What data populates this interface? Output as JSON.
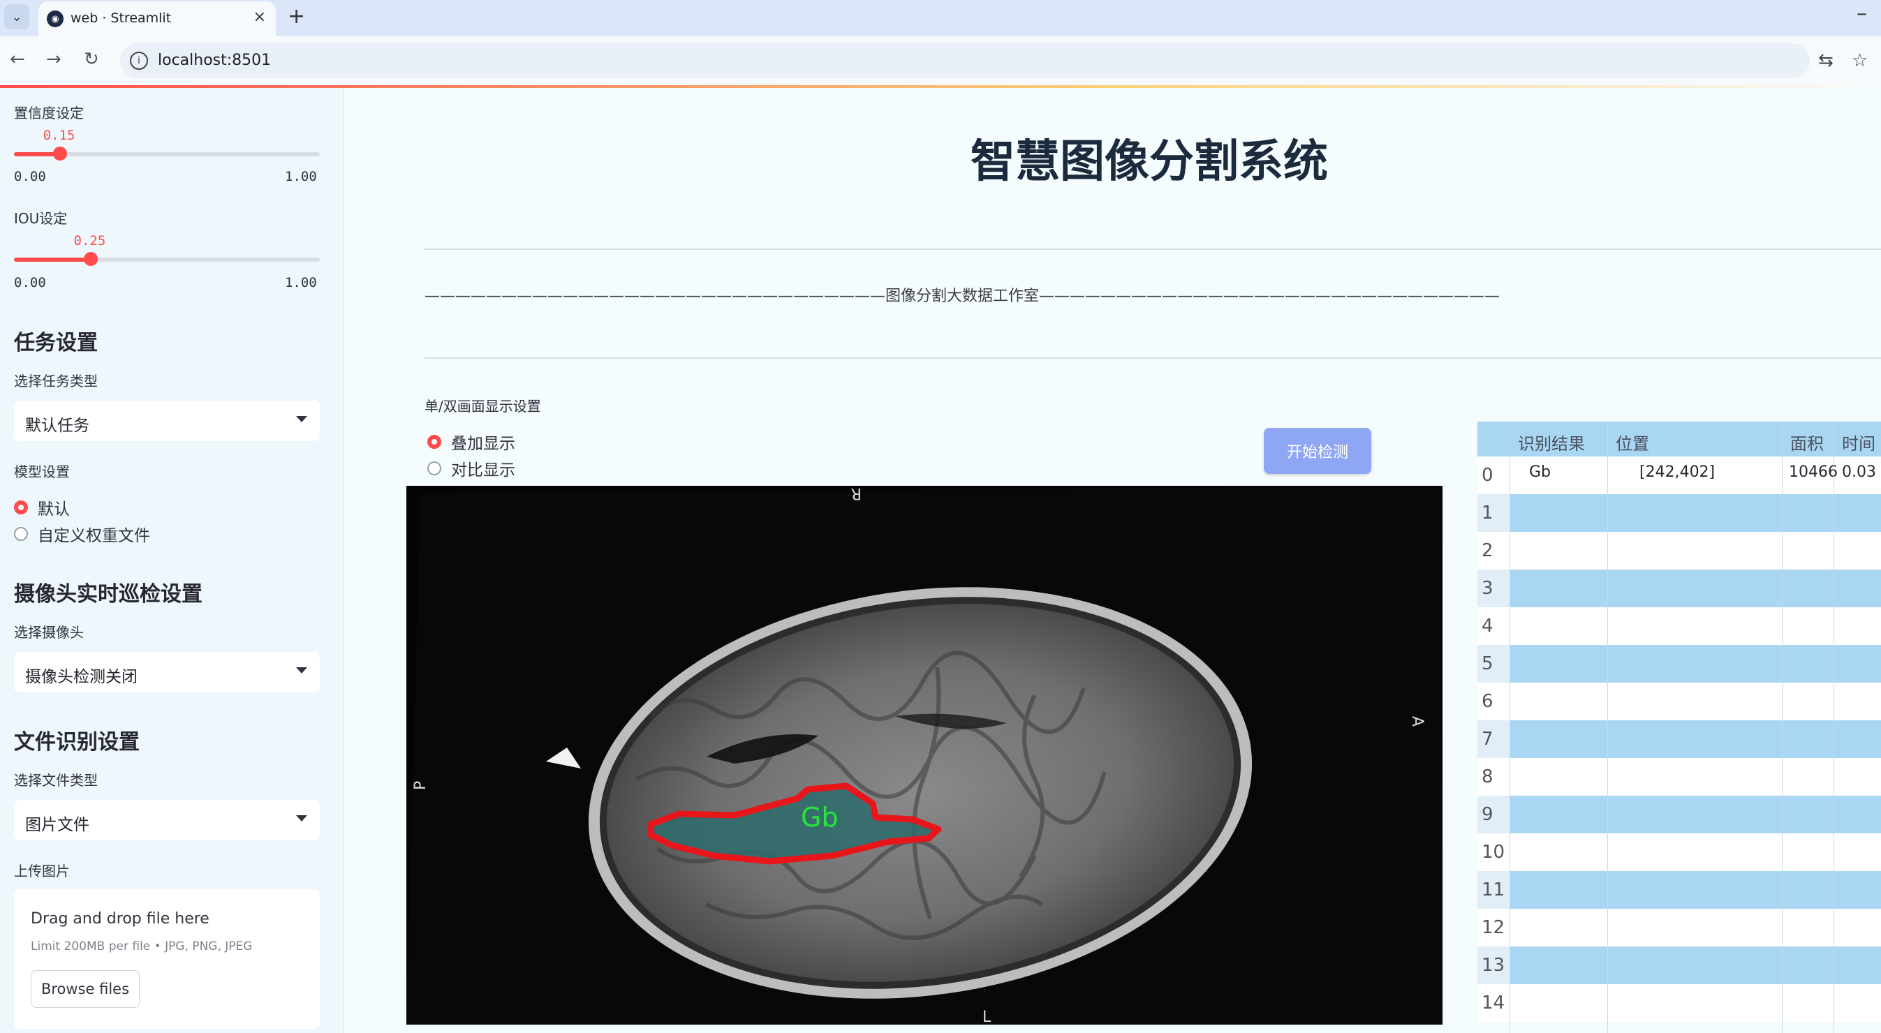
{
  "browser": {
    "tab_title": "web · Streamlit",
    "url": "localhost:8501",
    "new_tab_symbol": "+",
    "close_symbol": "×",
    "minimize_symbol": "–"
  },
  "sidebar": {
    "conf_label": "置信度设定",
    "conf_value": "0.15",
    "conf_fraction": 0.15,
    "conf_min": "0.00",
    "conf_max": "1.00",
    "iou_label": "IOU设定",
    "iou_value": "0.25",
    "iou_fraction": 0.25,
    "iou_min": "0.00",
    "iou_max": "1.00",
    "task_heading": "任务设置",
    "task_type_label": "选择任务类型",
    "task_type_value": "默认任务",
    "model_label": "模型设置",
    "model_options": [
      "默认",
      "自定义权重文件"
    ],
    "model_selected": 0,
    "camera_heading": "摄像头实时巡检设置",
    "camera_label": "选择摄像头",
    "camera_value": "摄像头检测关闭",
    "file_heading": "文件识别设置",
    "file_type_label": "选择文件类型",
    "file_type_value": "图片文件",
    "upload_label": "上传图片",
    "dropzone_title": "Drag and drop file here",
    "dropzone_limit": "Limit 200MB per file • JPG, PNG, JPEG",
    "browse_label": "Browse files"
  },
  "main": {
    "title": "智慧图像分割系统",
    "divider_text": "——————————————————————————————图像分割大数据工作室——————————————————————————————",
    "display_label": "单/双画面显示设置",
    "display_options": [
      "叠加显示",
      "对比显示"
    ],
    "display_selected": 0,
    "start_button": "开始检测",
    "image": {
      "orientation_top": "R",
      "orientation_right": "A",
      "orientation_left": "P",
      "orientation_bottom": "L",
      "detection_label": "Gb"
    }
  },
  "table": {
    "columns": [
      "识别结果",
      "位置",
      "面积",
      "时间"
    ],
    "rows": [
      {
        "index": "0",
        "result": "Gb",
        "position": "[242,402]",
        "area": "10466",
        "time": "0.03"
      },
      {
        "index": "1"
      },
      {
        "index": "2"
      },
      {
        "index": "3"
      },
      {
        "index": "4"
      },
      {
        "index": "5"
      },
      {
        "index": "6"
      },
      {
        "index": "7"
      },
      {
        "index": "8"
      },
      {
        "index": "9"
      },
      {
        "index": "10"
      },
      {
        "index": "11"
      },
      {
        "index": "12"
      },
      {
        "index": "13"
      },
      {
        "index": "14"
      }
    ]
  },
  "colors": {
    "accent": "#ff4b4b",
    "button": "#8ea6f3",
    "table_header": "#a9d6f2",
    "mask_outline": "#e8161b",
    "mask_fill": "#2d6b6b",
    "label_green": "#27e63a"
  }
}
